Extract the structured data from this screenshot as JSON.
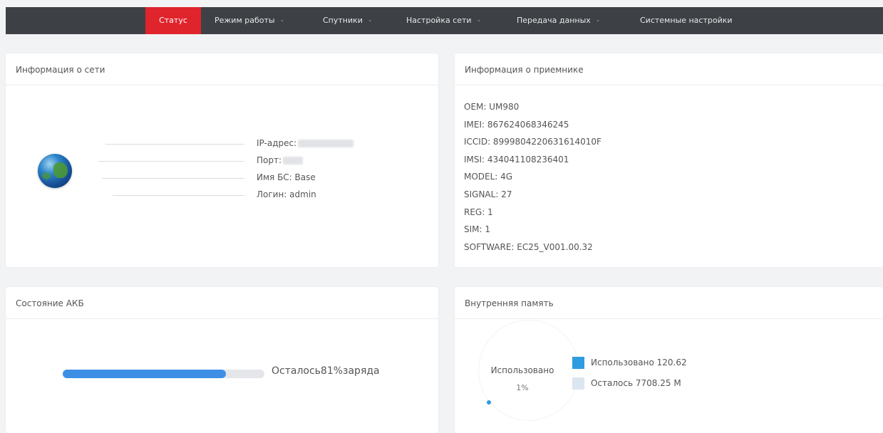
{
  "nav": {
    "items": [
      {
        "label": "Статус",
        "active": true,
        "dropdown": false
      },
      {
        "label": "Режим работы",
        "active": false,
        "dropdown": true
      },
      {
        "label": "Спутники",
        "active": false,
        "dropdown": true
      },
      {
        "label": "Настройка сети",
        "active": false,
        "dropdown": true
      },
      {
        "label": "Передача данных",
        "active": false,
        "dropdown": true
      },
      {
        "label": "Системные настройки",
        "active": false,
        "dropdown": false
      }
    ],
    "colors": {
      "bar": "#3d4146",
      "active": "#e0242c"
    }
  },
  "network": {
    "title": "Информация о сети",
    "ip_label": "IP-адрес:",
    "port_label": "Порт:",
    "base_label": "Имя БС: Base",
    "login_label": "Логин: admin"
  },
  "receiver": {
    "title": "Информация о приемнике",
    "lines": [
      "OEM: UM980",
      "IMEI: 867624068346245",
      "ICCID: 8999804220631614010F",
      "IMSI: 434041108236401",
      "MODEL: 4G",
      "SIGNAL: 27",
      "REG: 1",
      "SIM: 1",
      "SOFTWARE: EC25_V001.00.32"
    ]
  },
  "battery": {
    "title": "Состояние АКБ",
    "percent": 81,
    "text": "Осталось81%заряда",
    "fill_color": "#3d8fe6"
  },
  "memory": {
    "title": "Внутренняя память",
    "center_label": "Использовано",
    "center_percent": "1%",
    "legend_used": "Использовано 120.62",
    "legend_left": "Осталось 7708.25 M",
    "colors": {
      "used": "#2f9be0",
      "left": "#dce6f0"
    }
  }
}
